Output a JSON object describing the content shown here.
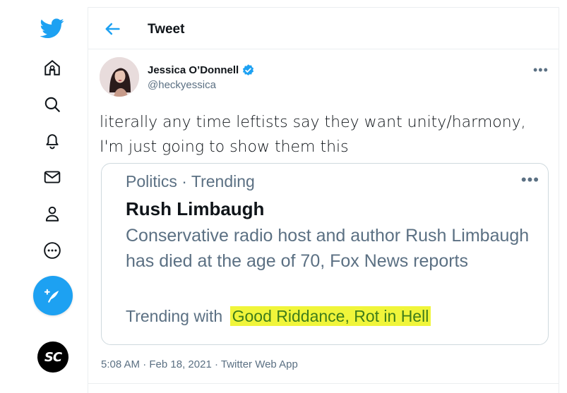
{
  "colors": {
    "accent": "#1da1f2",
    "highlight": "#f0f53a",
    "secondary_text": "#5b7083"
  },
  "sidebar": {
    "icons": [
      "twitter-logo-icon",
      "home-icon",
      "search-icon",
      "notifications-icon",
      "messages-icon",
      "profile-icon",
      "more-icon",
      "compose-tweet-icon"
    ],
    "account_badge": "SC"
  },
  "header": {
    "title": "Tweet"
  },
  "tweet": {
    "author_name": "Jessica O’Donnell",
    "author_handle": "@heckyessica",
    "more": "•••",
    "text_line1": "literally any time leftists say they want unity/harmony,",
    "text_line2": "I'm just going to show them this",
    "card": {
      "category": "Politics · Trending",
      "more": "•••",
      "title": "Rush Limbaugh",
      "description": "Conservative radio host and author Rush Limbaugh has died at the age of 70, Fox News reports",
      "trending_prefix": "Trending with",
      "trending_topics": "Good Riddance, Rot in Hell"
    },
    "time": "5:08 AM",
    "sep1": " · ",
    "date": "Feb 18, 2021",
    "sep2": " · ",
    "source": "Twitter Web App"
  }
}
